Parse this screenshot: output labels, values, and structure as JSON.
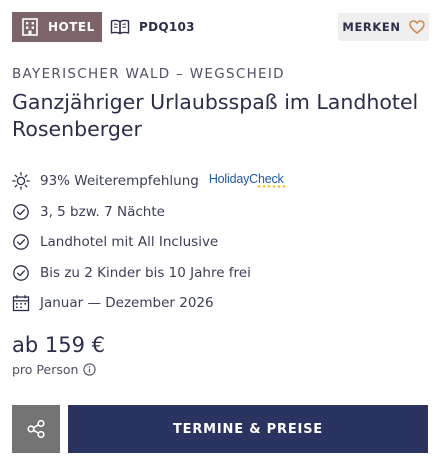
{
  "badges": {
    "type_label": "HOTEL",
    "type_icon": "hotel-building-icon",
    "code": "PDQ103",
    "code_icon": "book-icon"
  },
  "merken": {
    "label": "MERKEN",
    "icon": "heart-outline-icon",
    "icon_color": "#c98a4b"
  },
  "region": "BAYERISCHER WALD – WEGSCHEID",
  "title": "Ganzjähriger Urlaubsspaß im Landhotel Rosenberger",
  "features": [
    {
      "icon": "sun-icon",
      "text": "93% Weiterempfehlung"
    },
    {
      "icon": "check-circle-icon",
      "text": "3, 5 bzw. 7 Nächte"
    },
    {
      "icon": "check-circle-icon",
      "text": "Landhotel mit All Inclusive"
    },
    {
      "icon": "check-circle-icon",
      "text": "Bis zu 2 Kinder bis 10 Jahre frei"
    },
    {
      "icon": "calendar-icon",
      "text": "Januar — Dezember 2026"
    }
  ],
  "holidaycheck": {
    "name": "HolidayCheck",
    "stars": "★★★★★★"
  },
  "price": {
    "label": "ab 159 €",
    "unit": "pro Person",
    "info_icon": "info-icon"
  },
  "actions": {
    "share_icon": "share-icon",
    "cta_label": "TERMINE & PREISE"
  },
  "colors": {
    "badge_bg": "#7d6468",
    "cta_bg": "#2b3361",
    "share_bg": "#747474",
    "merken_bg": "#efefef",
    "text": "#2b2e4a"
  }
}
